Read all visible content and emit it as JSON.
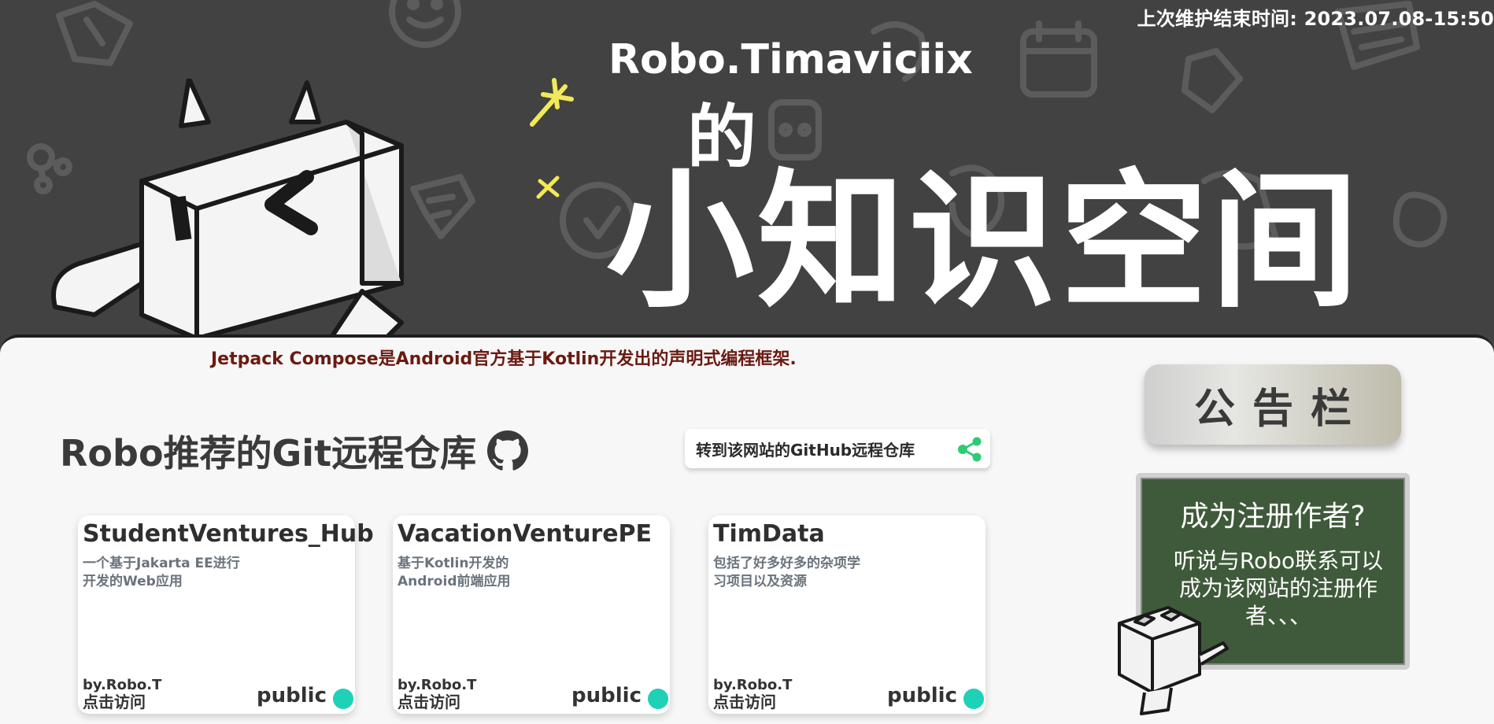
{
  "header": {
    "maintenance": "上次维护结束时间: 2023.07.08-15:50",
    "site_name": "Robo.Timaviciix",
    "de": "的",
    "space_title": "小知识空间"
  },
  "tagline": "Jetpack Compose是Android官方基于Kotlin开发出的声明式编程框架.",
  "repos_section": {
    "title": "Robo推荐的Git远程仓库",
    "github_link_label": "转到该网站的GitHub远程仓库"
  },
  "repos": [
    {
      "name": "StudentVentures_Hub",
      "desc": "一个基于Jakarta EE进行开发的Web应用",
      "author": "by.Robo.T",
      "visit": "点击访问",
      "visibility": "public"
    },
    {
      "name": "VacationVenturePE",
      "desc": "基于Kotlin开发的Android前端应用",
      "author": "by.Robo.T",
      "visit": "点击访问",
      "visibility": "public"
    },
    {
      "name": "TimData",
      "desc": "包括了好多好多的杂项学习项目以及资源",
      "author": "by.Robo.T",
      "visit": "点击访问",
      "visibility": "public"
    }
  ],
  "notice": {
    "button_label": "公告栏",
    "board_title": "成为注册作者?",
    "board_text": "听说与Robo联系可以成为该网站的注册作者、、、"
  },
  "colors": {
    "hero_bg": "#424242",
    "panel_bg": "#f7f7f7",
    "tagline": "#6a1a12",
    "public_dot": "#1fd1b6",
    "board": "#3f5a3a",
    "share_icon": "#2ecc71",
    "sparkle": "#f2e85a"
  },
  "icons": [
    "github-icon",
    "share-icon",
    "sparkle-icon",
    "robot-mascot"
  ]
}
